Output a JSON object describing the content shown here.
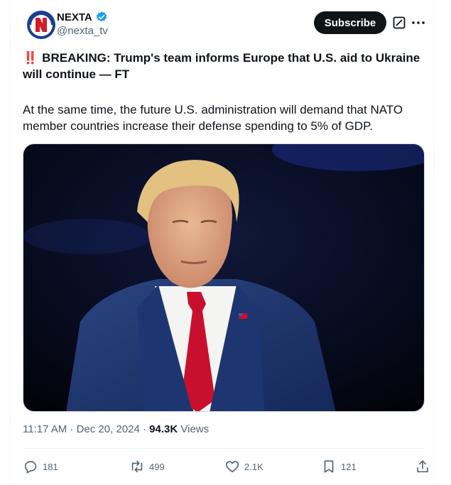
{
  "author": {
    "display_name": "NEXTA",
    "handle": "@nexta_tv",
    "verified": true,
    "avatar_letter": "N"
  },
  "header": {
    "subscribe_label": "Subscribe"
  },
  "post": {
    "alert_icon": "‼️",
    "headline": "BREAKING: Trump's team informs Europe that U.S. aid to Ukraine will continue — FT",
    "body": "At the same time, the future U.S. administration will demand that NATO member countries increase their defense spending to 5% of GDP.",
    "timestamp": "11:17 AM · Dec 20, 2024",
    "separator": " · ",
    "views_count": "94.3K",
    "views_label": "Views"
  },
  "actions": {
    "replies": "181",
    "reposts": "499",
    "likes": "2.1K",
    "bookmarks": "121"
  },
  "colors": {
    "accent": "#1d9bf0",
    "button_bg": "#0f1419",
    "muted_text": "#536471",
    "tie_red": "#c8102e",
    "suit_navy": "#1f3566"
  },
  "icons": [
    "verified-badge-icon",
    "grok-icon",
    "more-icon",
    "reply-icon",
    "repost-icon",
    "like-icon",
    "bookmark-icon",
    "share-icon"
  ]
}
